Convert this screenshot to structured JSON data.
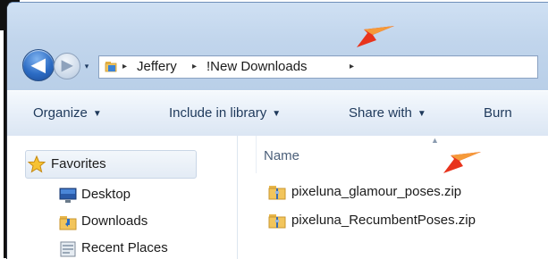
{
  "window": {
    "breadcrumb": [
      "Jeffery",
      "!New Downloads"
    ],
    "nav_back_glyph": "◀",
    "nav_forward_glyph": "▶",
    "history_glyph": "▾",
    "crumb_separator": "▸"
  },
  "toolbar": {
    "items": [
      {
        "label": "Organize",
        "has_dropdown": true
      },
      {
        "label": "Include in library",
        "has_dropdown": true
      },
      {
        "label": "Share with",
        "has_dropdown": true
      },
      {
        "label": "Burn",
        "has_dropdown": false
      }
    ],
    "dropdown_glyph": "▼"
  },
  "sidebar": {
    "items": [
      {
        "label": "Favorites",
        "icon": "star-icon"
      },
      {
        "label": "Desktop",
        "icon": "desktop-icon"
      },
      {
        "label": "Downloads",
        "icon": "downloads-folder-icon"
      },
      {
        "label": "Recent Places",
        "icon": "recent-places-icon"
      }
    ]
  },
  "content": {
    "column_header": "Name",
    "sort_glyph": "▲",
    "files": [
      {
        "name": "pixeluna_glamour_poses.zip",
        "icon": "zip-folder-icon"
      },
      {
        "name": "pixeluna_RecumbentPoses.zip",
        "icon": "zip-folder-icon"
      }
    ]
  },
  "annotations": [
    {
      "icon": "red-arrow-icon",
      "target": "address-bar"
    },
    {
      "icon": "red-arrow-icon",
      "target": "file-list"
    }
  ],
  "colors": {
    "accent": "#2c6cc4",
    "titlebar": "#c1d5ec",
    "toolbar_text": "#1e395b",
    "arrow": "#e8331c"
  }
}
